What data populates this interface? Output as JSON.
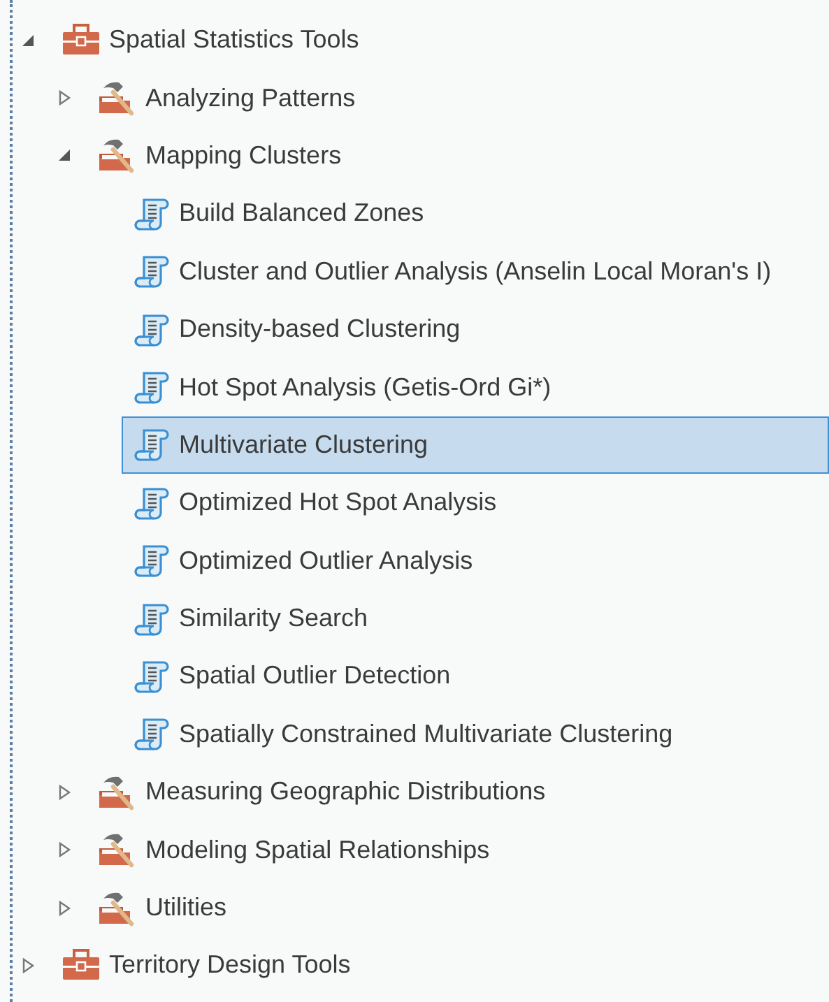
{
  "tree": [
    {
      "kind": "toolbox",
      "label": "Spatial Statistics Tools",
      "expanded": true,
      "selected": false,
      "children": [
        {
          "kind": "toolset",
          "label": "Analyzing Patterns",
          "expanded": false,
          "selected": false
        },
        {
          "kind": "toolset",
          "label": "Mapping Clusters",
          "expanded": true,
          "selected": false,
          "children": [
            {
              "kind": "tool",
              "label": "Build Balanced Zones",
              "selected": false
            },
            {
              "kind": "tool",
              "label": "Cluster and Outlier Analysis (Anselin Local Moran's I)",
              "selected": false
            },
            {
              "kind": "tool",
              "label": "Density-based Clustering",
              "selected": false
            },
            {
              "kind": "tool",
              "label": "Hot Spot Analysis (Getis-Ord Gi*)",
              "selected": false
            },
            {
              "kind": "tool",
              "label": "Multivariate Clustering",
              "selected": true
            },
            {
              "kind": "tool",
              "label": "Optimized Hot Spot Analysis",
              "selected": false
            },
            {
              "kind": "tool",
              "label": "Optimized Outlier Analysis",
              "selected": false
            },
            {
              "kind": "tool",
              "label": "Similarity Search",
              "selected": false
            },
            {
              "kind": "tool",
              "label": "Spatial Outlier Detection",
              "selected": false
            },
            {
              "kind": "tool",
              "label": "Spatially Constrained Multivariate Clustering",
              "selected": false
            }
          ]
        },
        {
          "kind": "toolset",
          "label": "Measuring Geographic Distributions",
          "expanded": false,
          "selected": false
        },
        {
          "kind": "toolset",
          "label": "Modeling Spatial Relationships",
          "expanded": false,
          "selected": false
        },
        {
          "kind": "toolset",
          "label": "Utilities",
          "expanded": false,
          "selected": false
        }
      ]
    },
    {
      "kind": "toolbox",
      "label": "Territory Design Tools",
      "expanded": false,
      "selected": false
    }
  ]
}
